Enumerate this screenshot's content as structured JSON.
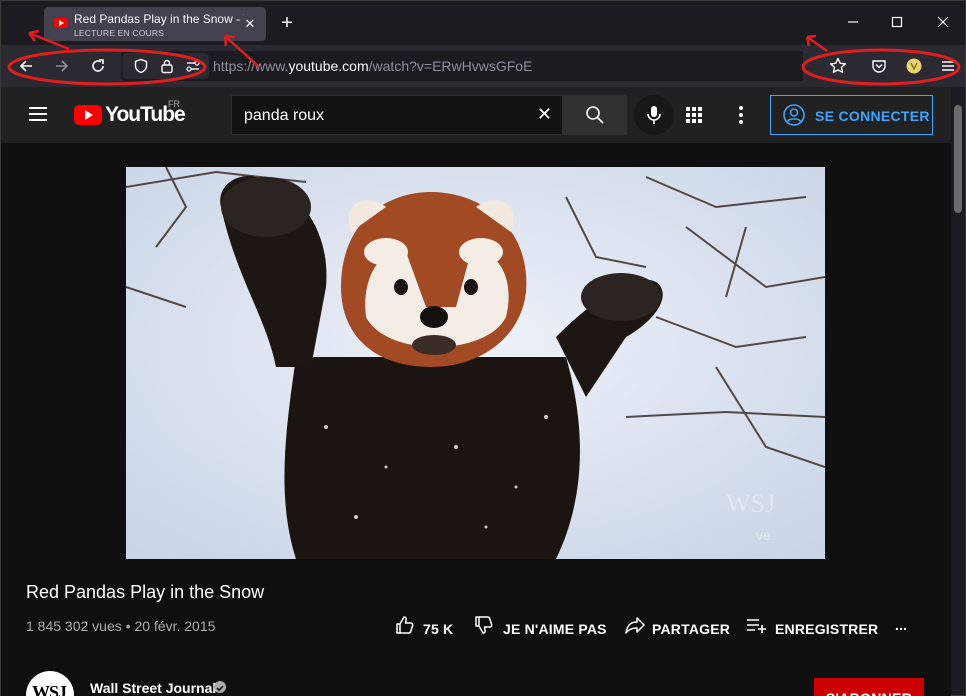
{
  "browser": {
    "tab": {
      "title": "Red Pandas Play in the Snow - YouTube",
      "subtitle": "LECTURE EN COURS",
      "close_label": "✕"
    },
    "new_tab_label": "+",
    "window_controls": {
      "minimize": "—",
      "maximize": "☐",
      "close": "✕"
    },
    "nav": {
      "back": "←",
      "forward": "→",
      "reload": "↻",
      "url_prefix": "https://www.",
      "url_domain": "youtube.com",
      "url_path": "/watch?v=ERwHvwsGFoE"
    },
    "icons": [
      "back-icon",
      "forward-icon",
      "reload-icon",
      "shield-icon",
      "lock-icon",
      "permissions-icon",
      "star-icon",
      "pocket-icon",
      "extension-icon",
      "menu-icon"
    ]
  },
  "youtube": {
    "logo_text": "YouTube",
    "country": "FR",
    "search": {
      "value": "panda roux",
      "clear": "✕"
    },
    "signin_label": "SE CONNECTER",
    "video": {
      "title": "Red Pandas Play in the Snow",
      "views": "1 845 302 vues",
      "separator": "•",
      "date": "20 févr. 2015",
      "likes": "75 K",
      "dislike_label": "JE N'AIME PAS",
      "share_label": "PARTAGER",
      "save_label": "ENREGISTRER",
      "more_label": "...",
      "watermark": "WSJ",
      "watermark_sub": "ve"
    },
    "channel": {
      "name": "Wall Street Journal",
      "avatar_text": "WSJ",
      "subscribe_label": "S'ABONNER"
    }
  },
  "colors": {
    "annotation": "#e01e1e",
    "youtube_red": "#ff0000",
    "signin_blue": "#3ea6ff",
    "subscribe_red": "#cc0000"
  }
}
